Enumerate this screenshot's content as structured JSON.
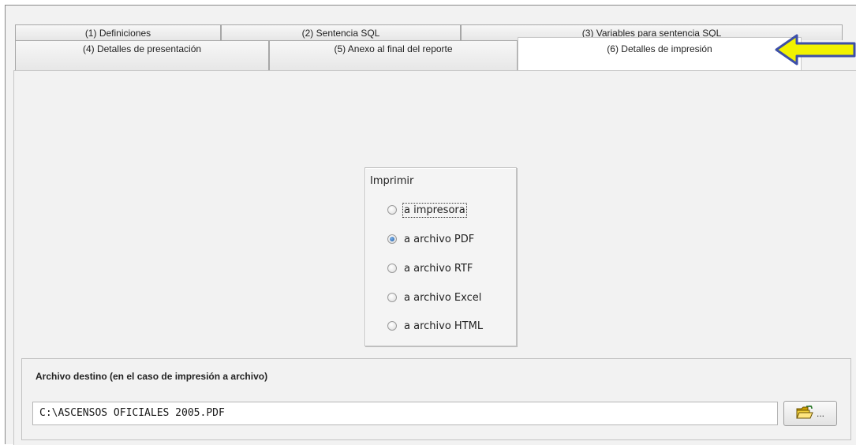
{
  "tabs": {
    "row1": [
      "(1) Definiciones",
      "(2) Sentencia SQL",
      "(3) Variables para sentencia SQL"
    ],
    "row2": [
      "(4) Detalles de presentación",
      "(5) Anexo al final del reporte",
      "(6) Detalles de impresión"
    ],
    "active": "(6) Detalles de impresión"
  },
  "print": {
    "title": "Imprimir",
    "options": [
      "a impresora",
      "a archivo PDF",
      "a archivo RTF",
      "a archivo Excel",
      "a archivo HTML"
    ],
    "selected": "a archivo PDF"
  },
  "destination": {
    "label": "Archivo destino (en el caso de impresión a archivo)",
    "path": "C:\\ASCENSOS OFICIALES 2005.PDF",
    "browse_label": "..."
  },
  "colors": {
    "arrow_fill": "#f2f200",
    "arrow_outline": "#3d4fa8",
    "radio_checked": "#1f5ea8"
  },
  "icons": {
    "browse": "open-folder-icon",
    "pointer": "yellow-left-arrow"
  }
}
